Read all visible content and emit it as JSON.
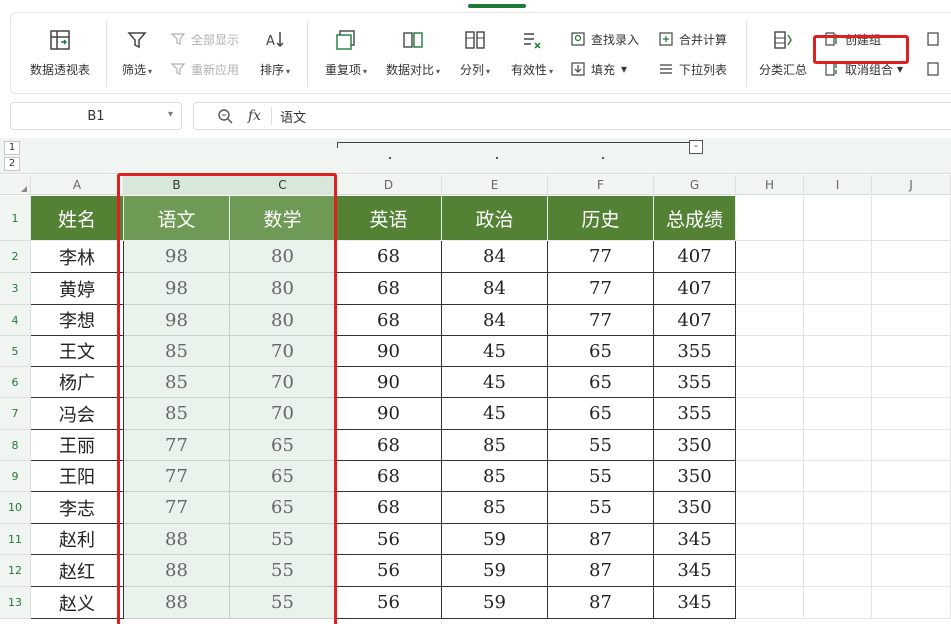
{
  "ribbon": {
    "pivot_label": "数据透视表",
    "filter_label": "筛选",
    "show_all_label": "全部显示",
    "reapply_label": "重新应用",
    "sort_label": "排序",
    "duplicates_label": "重复项",
    "compare_label": "数据对比",
    "split_label": "分列",
    "validity_label": "有效性",
    "lookup_label": "查找录入",
    "fill_label": "填充",
    "consolidate_label": "合并计算",
    "dropdown_label": "下拉列表",
    "subtotal_label": "分类汇总",
    "create_group_label": "创建组",
    "ungroup_label": "取消组合"
  },
  "formula_bar": {
    "cell_ref": "B1",
    "fx_label": "fx",
    "content": "语文"
  },
  "outline": {
    "levels": [
      "1",
      "2"
    ],
    "collapse_label": "-"
  },
  "columns": [
    "A",
    "B",
    "C",
    "D",
    "E",
    "F",
    "G",
    "H",
    "I",
    "J"
  ],
  "row_numbers": [
    "1",
    "2",
    "3",
    "4",
    "5",
    "6",
    "7",
    "8",
    "9",
    "10",
    "11",
    "12",
    "13"
  ],
  "table": {
    "headers": [
      "姓名",
      "语文",
      "数学",
      "英语",
      "政治",
      "历史",
      "总成绩"
    ],
    "rows": [
      [
        "李林",
        "98",
        "80",
        "68",
        "84",
        "77",
        "407"
      ],
      [
        "黄婷",
        "98",
        "80",
        "68",
        "84",
        "77",
        "407"
      ],
      [
        "李想",
        "98",
        "80",
        "68",
        "84",
        "77",
        "407"
      ],
      [
        "王文",
        "85",
        "70",
        "90",
        "45",
        "65",
        "355"
      ],
      [
        "杨广",
        "85",
        "70",
        "90",
        "45",
        "65",
        "355"
      ],
      [
        "冯会",
        "85",
        "70",
        "90",
        "45",
        "65",
        "355"
      ],
      [
        "王丽",
        "77",
        "65",
        "68",
        "85",
        "55",
        "350"
      ],
      [
        "王阳",
        "77",
        "65",
        "68",
        "85",
        "55",
        "350"
      ],
      [
        "李志",
        "77",
        "65",
        "68",
        "85",
        "55",
        "350"
      ],
      [
        "赵利",
        "88",
        "55",
        "56",
        "59",
        "87",
        "345"
      ],
      [
        "赵红",
        "88",
        "55",
        "56",
        "59",
        "87",
        "345"
      ],
      [
        "赵义",
        "88",
        "55",
        "56",
        "59",
        "87",
        "345"
      ]
    ]
  },
  "colors": {
    "header_green": "#548235",
    "highlight_red": "#e02020",
    "selection_tint": "#eaf2ec"
  }
}
